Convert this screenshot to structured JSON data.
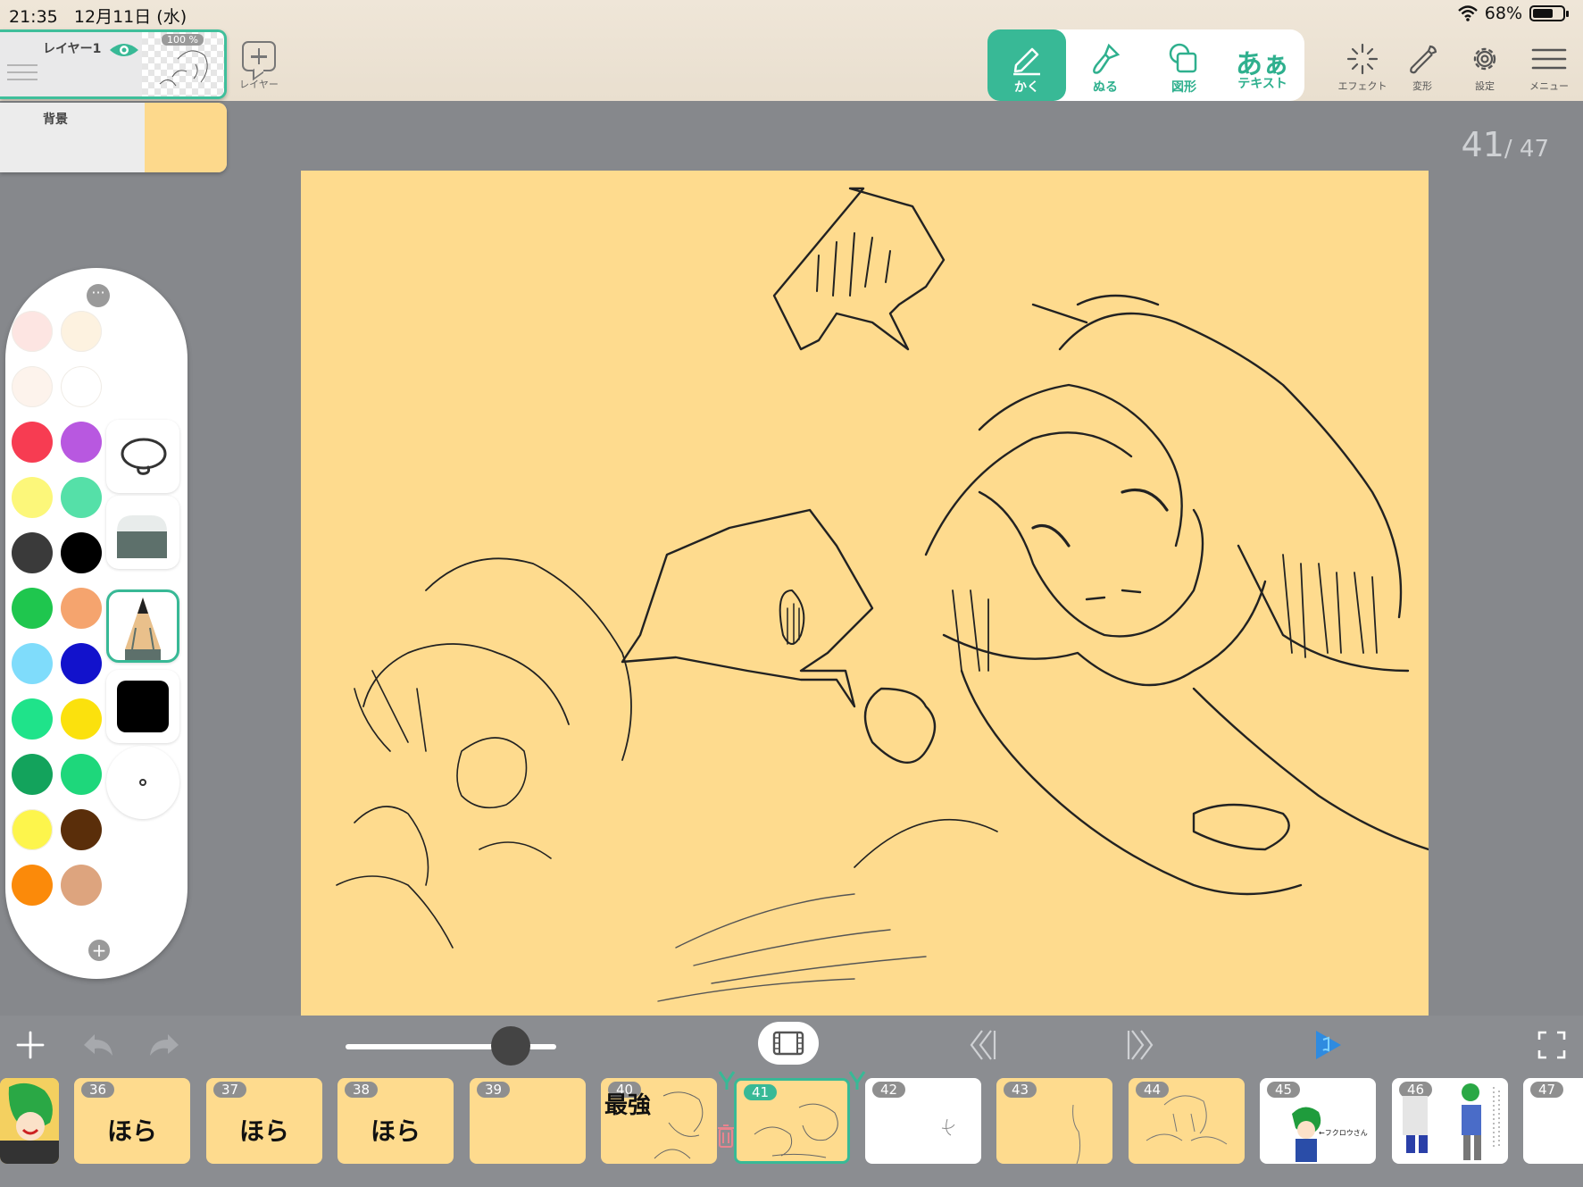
{
  "status": {
    "time": "21:35",
    "date": "12月11日 (水)",
    "battery": "68%",
    "battery_level": 0.68
  },
  "layers": [
    {
      "name": "レイヤー1",
      "opacity": "100 %"
    },
    {
      "name": "背景"
    }
  ],
  "add_layer_label": "レイヤー",
  "modes": [
    {
      "label": "かく",
      "icon": "pencil-icon",
      "active": true
    },
    {
      "label": "ぬる",
      "icon": "brush-icon"
    },
    {
      "label": "図形",
      "icon": "shapes-icon"
    },
    {
      "label": "テキスト",
      "glyph": "あぁ",
      "icon": "text-icon"
    }
  ],
  "tools": [
    {
      "label": "エフェクト",
      "icon": "effect-sparkle-icon"
    },
    {
      "label": "変形",
      "icon": "wrench-icon"
    },
    {
      "label": "設定",
      "icon": "gear-icon"
    },
    {
      "label": "メニュー",
      "icon": "menu-icon"
    }
  ],
  "frame_counter": {
    "current": "41",
    "total": "/ 47"
  },
  "palette": {
    "colors": [
      "#fde5e2",
      "#fdf2e0",
      "#fdf3ec",
      "#ffffff",
      "#f73c52",
      "#b858e0",
      "#fcf77a",
      "#55e0a8",
      "#3a3a3a",
      "#000000",
      "#1fc64e",
      "#f5a46e",
      "#7fdcfb",
      "#1212cc",
      "#1fe38a",
      "#fbe10d",
      "#13a35c",
      "#1ed77b",
      "#fdf54c",
      "#5a2e0a",
      "#fb8a0a",
      "#dda47e"
    ],
    "brush_color": "#000000"
  },
  "frames": [
    {
      "num": "36",
      "text": "ほら"
    },
    {
      "num": "37",
      "text": "ほら"
    },
    {
      "num": "38",
      "text": "ほら"
    },
    {
      "num": "39",
      "text": ""
    },
    {
      "num": "40",
      "text": "最強"
    },
    {
      "num": "41",
      "text": ""
    },
    {
      "num": "42",
      "text": ""
    },
    {
      "num": "43",
      "text": ""
    },
    {
      "num": "44",
      "text": ""
    },
    {
      "num": "45",
      "text": ""
    },
    {
      "num": "46",
      "text": ""
    },
    {
      "num": "47",
      "text": ""
    }
  ],
  "frame45_caption": "←フクロウさん",
  "colors": {
    "accent": "#38b996",
    "play": "#2f8be0",
    "canvas": "#fedb8e"
  }
}
